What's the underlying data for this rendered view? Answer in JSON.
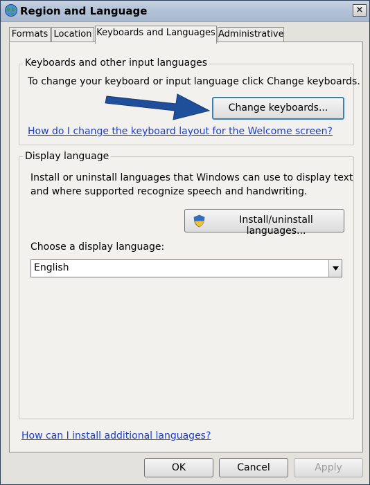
{
  "window": {
    "title": "Region and Language",
    "close_label": "×"
  },
  "tabs": [
    {
      "label": "Formats"
    },
    {
      "label": "Location"
    },
    {
      "label": "Keyboards and Languages"
    },
    {
      "label": "Administrative"
    }
  ],
  "keyboards": {
    "legend": "Keyboards and other input languages",
    "description": "To change your keyboard or input language click Change keyboards.",
    "change_button": "Change keyboards...",
    "welcome_link": "How do I change the keyboard layout for the Welcome screen?"
  },
  "display_language": {
    "legend": "Display language",
    "description_line1": "Install or uninstall languages that Windows can use to display text",
    "description_line2": "and where supported recognize speech and handwriting.",
    "install_button": "Install/uninstall languages...",
    "choose_label": "Choose a display language:",
    "selected": "English"
  },
  "additional_link": "How can I install additional languages?",
  "footer": {
    "ok": "OK",
    "cancel": "Cancel",
    "apply": "Apply"
  },
  "colors": {
    "arrow": "#1f4f9a",
    "link": "#1a3ec4"
  },
  "icons": [
    "globe-icon",
    "close-icon",
    "shield-icon",
    "dropdown-arrow-icon",
    "annotation-arrow"
  ]
}
